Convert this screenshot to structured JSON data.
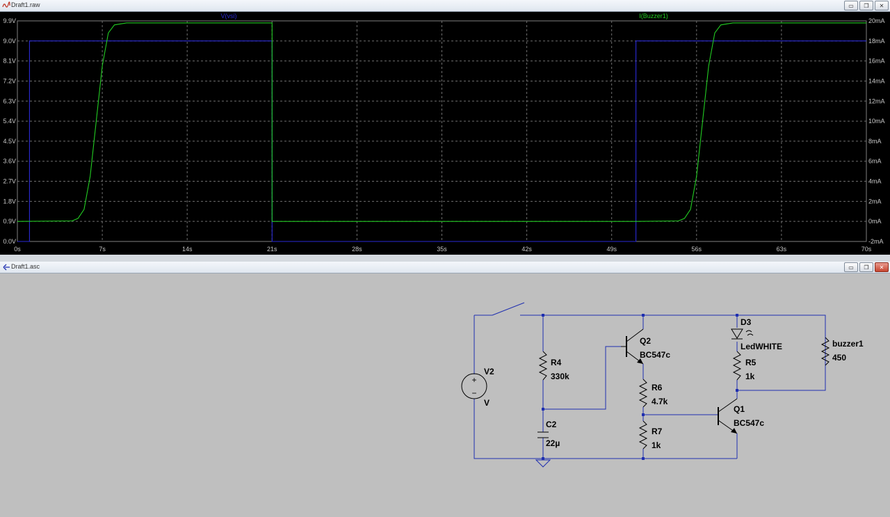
{
  "waveform_window": {
    "title": "Draft1.raw",
    "buttons": {
      "minimize": "▭",
      "restore": "❐",
      "close": "✕"
    }
  },
  "schematic_window": {
    "title": "Draft1.asc",
    "buttons": {
      "minimize": "▭",
      "restore": "❐",
      "close": "✕"
    }
  },
  "chart_data": {
    "type": "line",
    "x_unit": "s",
    "xlim": [
      0,
      70
    ],
    "x_ticks": [
      "0s",
      "7s",
      "14s",
      "21s",
      "28s",
      "35s",
      "42s",
      "49s",
      "56s",
      "63s",
      "70s"
    ],
    "y_left_ticks": [
      "9.9V",
      "9.0V",
      "8.1V",
      "7.2V",
      "6.3V",
      "5.4V",
      "4.5V",
      "3.6V",
      "2.7V",
      "1.8V",
      "0.9V",
      "0.0V"
    ],
    "y_left_lim": [
      0.0,
      9.9
    ],
    "y_right_ticks": [
      "20mA",
      "18mA",
      "16mA",
      "14mA",
      "12mA",
      "10mA",
      "8mA",
      "6mA",
      "4mA",
      "2mA",
      "0mA",
      "-2mA"
    ],
    "y_right_lim": [
      -2,
      20
    ],
    "grid": true,
    "series": [
      {
        "name": "V(vsi)",
        "color": "#2a2ad6",
        "axis": "left",
        "x": [
          0,
          1,
          1,
          21,
          21,
          51,
          51,
          70
        ],
        "y": [
          0,
          0,
          9.0,
          9.0,
          0,
          0,
          9.0,
          9.0
        ]
      },
      {
        "name": "I(Buzzer1)",
        "color": "#22cc22",
        "axis": "right",
        "x": [
          0,
          4.5,
          5,
          5.5,
          6,
          6.5,
          7,
          7.5,
          8,
          9,
          21,
          21,
          30,
          42,
          51,
          54.5,
          55,
          55.5,
          56,
          56.5,
          57,
          57.5,
          58,
          59,
          70
        ],
        "y": [
          0,
          0.05,
          0.3,
          1.2,
          4.5,
          10,
          15.5,
          18.8,
          19.6,
          19.8,
          19.8,
          0,
          0,
          0,
          0,
          0.05,
          0.3,
          1.2,
          4.5,
          10,
          15.5,
          18.8,
          19.6,
          19.8,
          19.8
        ]
      }
    ]
  },
  "schematic": {
    "components": {
      "V2": {
        "name": "V2",
        "value": "V"
      },
      "R4": {
        "name": "R4",
        "value": "330k"
      },
      "C2": {
        "name": "C2",
        "value": "22µ"
      },
      "Q2": {
        "name": "Q2",
        "value": "BC547c"
      },
      "R6": {
        "name": "R6",
        "value": "4.7k"
      },
      "R7": {
        "name": "R7",
        "value": "1k"
      },
      "D3": {
        "name": "D3",
        "value": "LedWHITE"
      },
      "R5": {
        "name": "R5",
        "value": "1k"
      },
      "Q1": {
        "name": "Q1",
        "value": "BC547c"
      },
      "BUZ": {
        "name": "buzzer1",
        "value": "450"
      }
    },
    "colors": {
      "wire": "#1f2fb0",
      "component": "#000000",
      "background": "#bfbfbf"
    }
  }
}
